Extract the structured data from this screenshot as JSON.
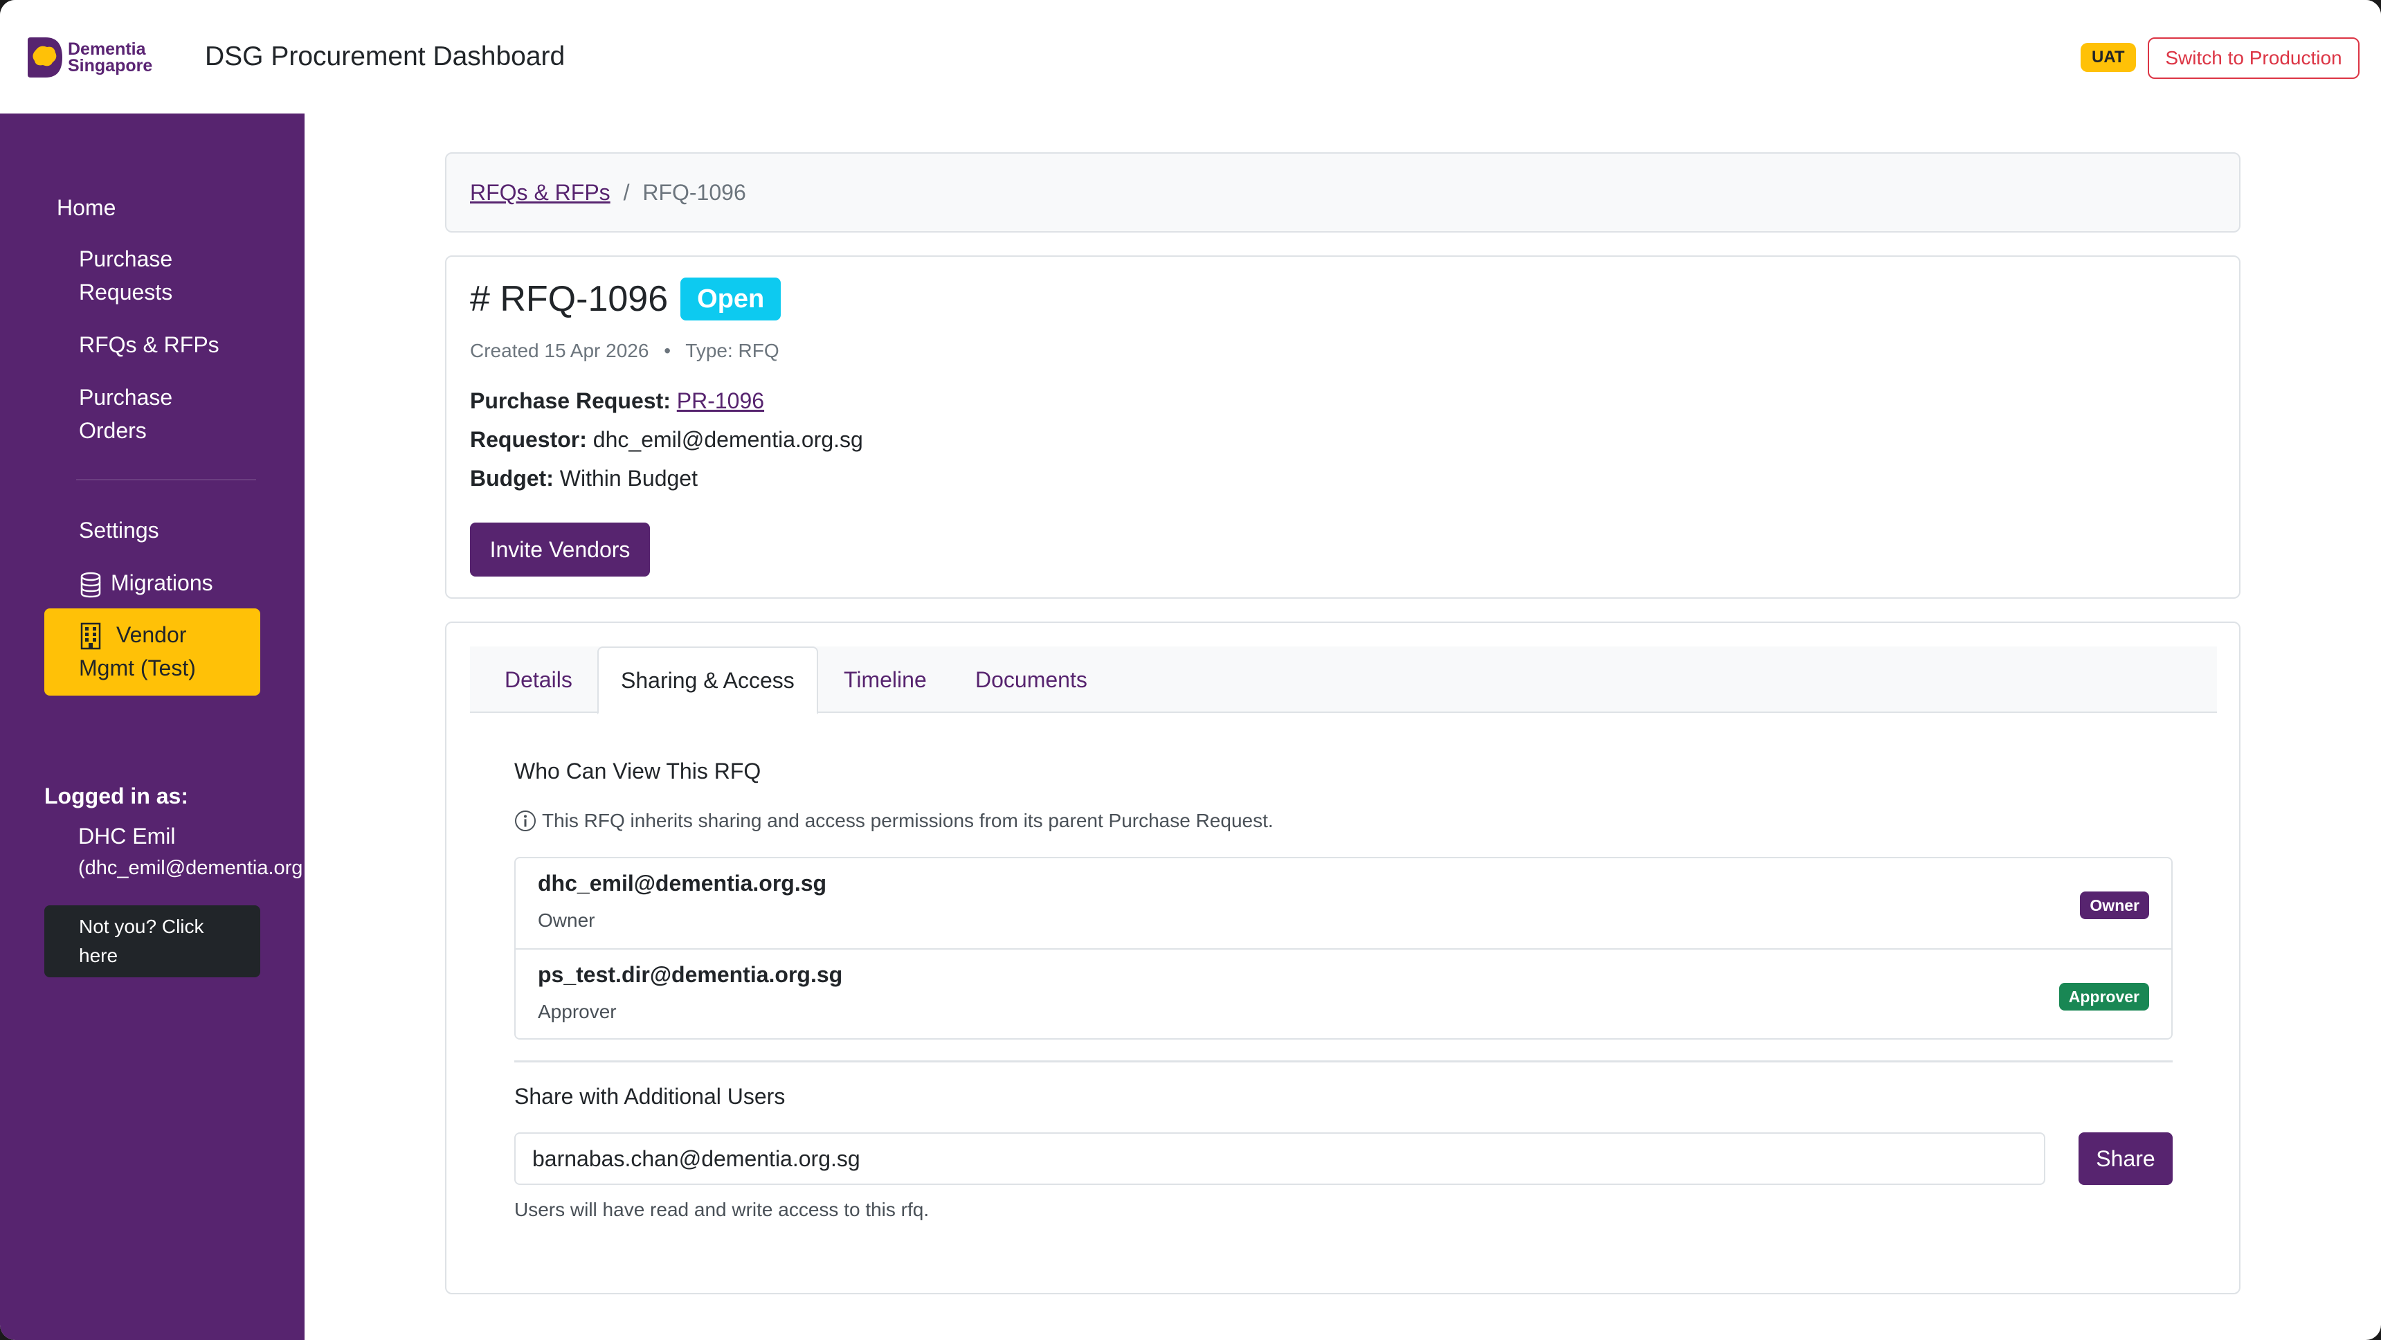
{
  "header": {
    "logo_line1": "Dementia",
    "logo_line2": "Singapore",
    "app_title": "DSG Procurement Dashboard",
    "env_badge": "UAT",
    "switch_button": "Switch to Production"
  },
  "sidebar": {
    "items": [
      {
        "label": "Home"
      },
      {
        "label_line1": "Purchase",
        "label_line2": "Requests"
      },
      {
        "label": "RFQs & RFPs"
      },
      {
        "label_line1": "Purchase",
        "label_line2": "Orders"
      },
      {
        "label": "Settings"
      },
      {
        "label": "Migrations",
        "icon": "database-icon"
      },
      {
        "label_line1": "Vendor",
        "label_line2": "Mgmt (Test)",
        "icon": "building-icon",
        "active": true
      }
    ],
    "logged_in_label": "Logged in as:",
    "user_name": "DHC Emil",
    "user_email": "(dhc_emil@dementia.org.sg)",
    "not_you_line1": "Not you? Click",
    "not_you_line2": "here"
  },
  "breadcrumb": {
    "parent": "RFQs & RFPs",
    "separator": "/",
    "current": "RFQ-1096"
  },
  "rfq": {
    "title": "# RFQ-1096",
    "status": "Open",
    "created": "Created 15 Apr 2026",
    "bullet": "•",
    "type": "Type: RFQ",
    "purchase_request_label": "Purchase Request:",
    "purchase_request_value": "PR-1096",
    "requestor_label": "Requestor:",
    "requestor_value": "dhc_emil@dementia.org.sg",
    "budget_label": "Budget:",
    "budget_value": "Within Budget",
    "invite_button": "Invite Vendors"
  },
  "tabs": [
    {
      "label": "Details"
    },
    {
      "label": "Sharing & Access",
      "active": true
    },
    {
      "label": "Timeline"
    },
    {
      "label": "Documents"
    }
  ],
  "sharing": {
    "title": "Who Can View This RFQ",
    "note": "This RFQ inherits sharing and access permissions from its parent Purchase Request.",
    "users": [
      {
        "email": "dhc_emil@dementia.org.sg",
        "role": "Owner",
        "badge": "Owner",
        "badge_color": "#57246f"
      },
      {
        "email": "ps_test.dir@dementia.org.sg",
        "role": "Approver",
        "badge": "Approver",
        "badge_color": "#198754"
      }
    ],
    "share_title": "Share with Additional Users",
    "share_input_value": "barnabas.chan@dementia.org.sg",
    "share_button": "Share",
    "share_help": "Users will have read and write access to this rfq."
  },
  "colors": {
    "brand_purple": "#57246f",
    "accent_yellow": "#ffc107",
    "danger": "#dc3545",
    "info": "#0dcaf0",
    "success": "#198754"
  }
}
